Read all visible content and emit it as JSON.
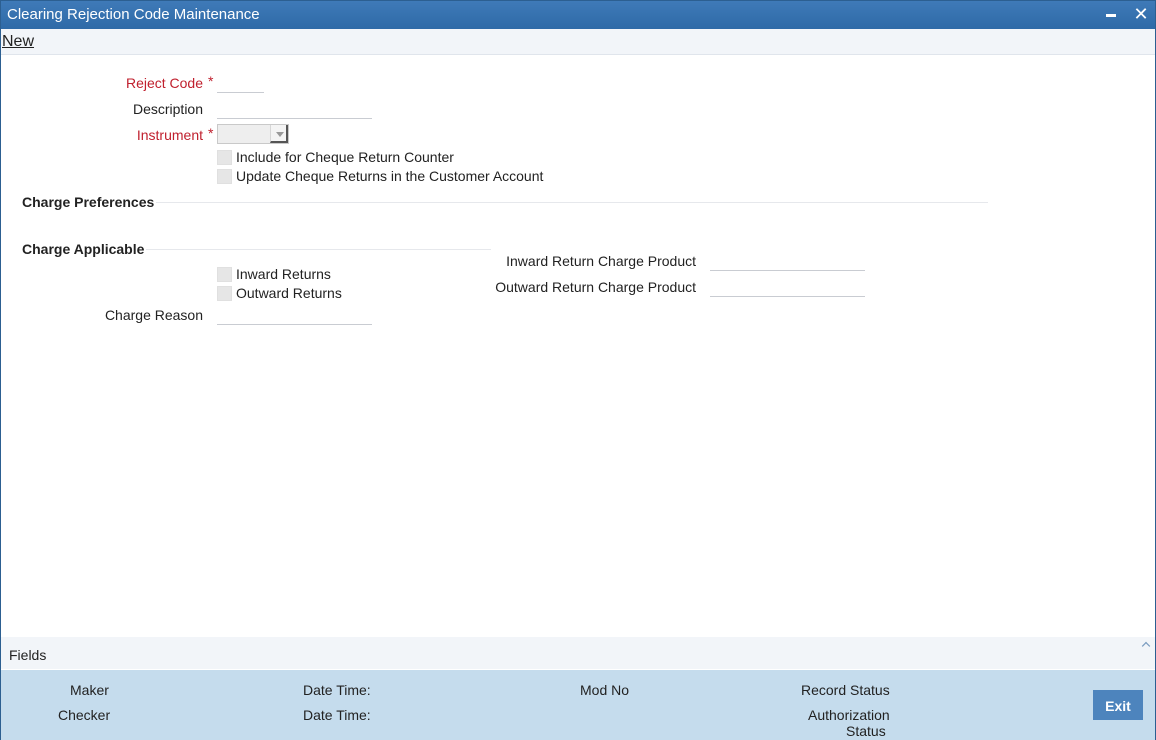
{
  "window": {
    "title": "Clearing Rejection Code Maintenance",
    "minimize_icon": "minimize-icon",
    "close_icon": "close-icon"
  },
  "menu": {
    "new_label": "New"
  },
  "form": {
    "reject_code": {
      "label": "Reject Code",
      "required_mark": "*",
      "value": ""
    },
    "description": {
      "label": "Description",
      "value": ""
    },
    "instrument": {
      "label": "Instrument",
      "required_mark": "*",
      "selected": ""
    },
    "include_cheque_return_counter": {
      "label": "Include for Cheque Return Counter",
      "checked": false
    },
    "update_cheque_returns": {
      "label": "Update Cheque Returns in the Customer Account",
      "checked": false
    }
  },
  "charge_preferences": {
    "heading": "Charge Preferences"
  },
  "charge_applicable": {
    "heading": "Charge Applicable",
    "inward_returns": {
      "label": "Inward Returns",
      "checked": false
    },
    "outward_returns": {
      "label": "Outward Returns",
      "checked": false
    },
    "charge_reason": {
      "label": "Charge Reason",
      "value": ""
    },
    "inward_return_charge_product": {
      "label": "Inward Return Charge Product",
      "value": ""
    },
    "outward_return_charge_product": {
      "label": "Outward Return Charge Product",
      "value": ""
    }
  },
  "footer": {
    "fields_label": "Fields",
    "maker_label": "Maker",
    "checker_label": "Checker",
    "date_time_label": "Date Time:",
    "mod_no_label": "Mod No",
    "record_status_label": "Record Status",
    "authorization_status_line1": "Authorization",
    "authorization_status_line2": "Status",
    "exit_label": "Exit"
  }
}
